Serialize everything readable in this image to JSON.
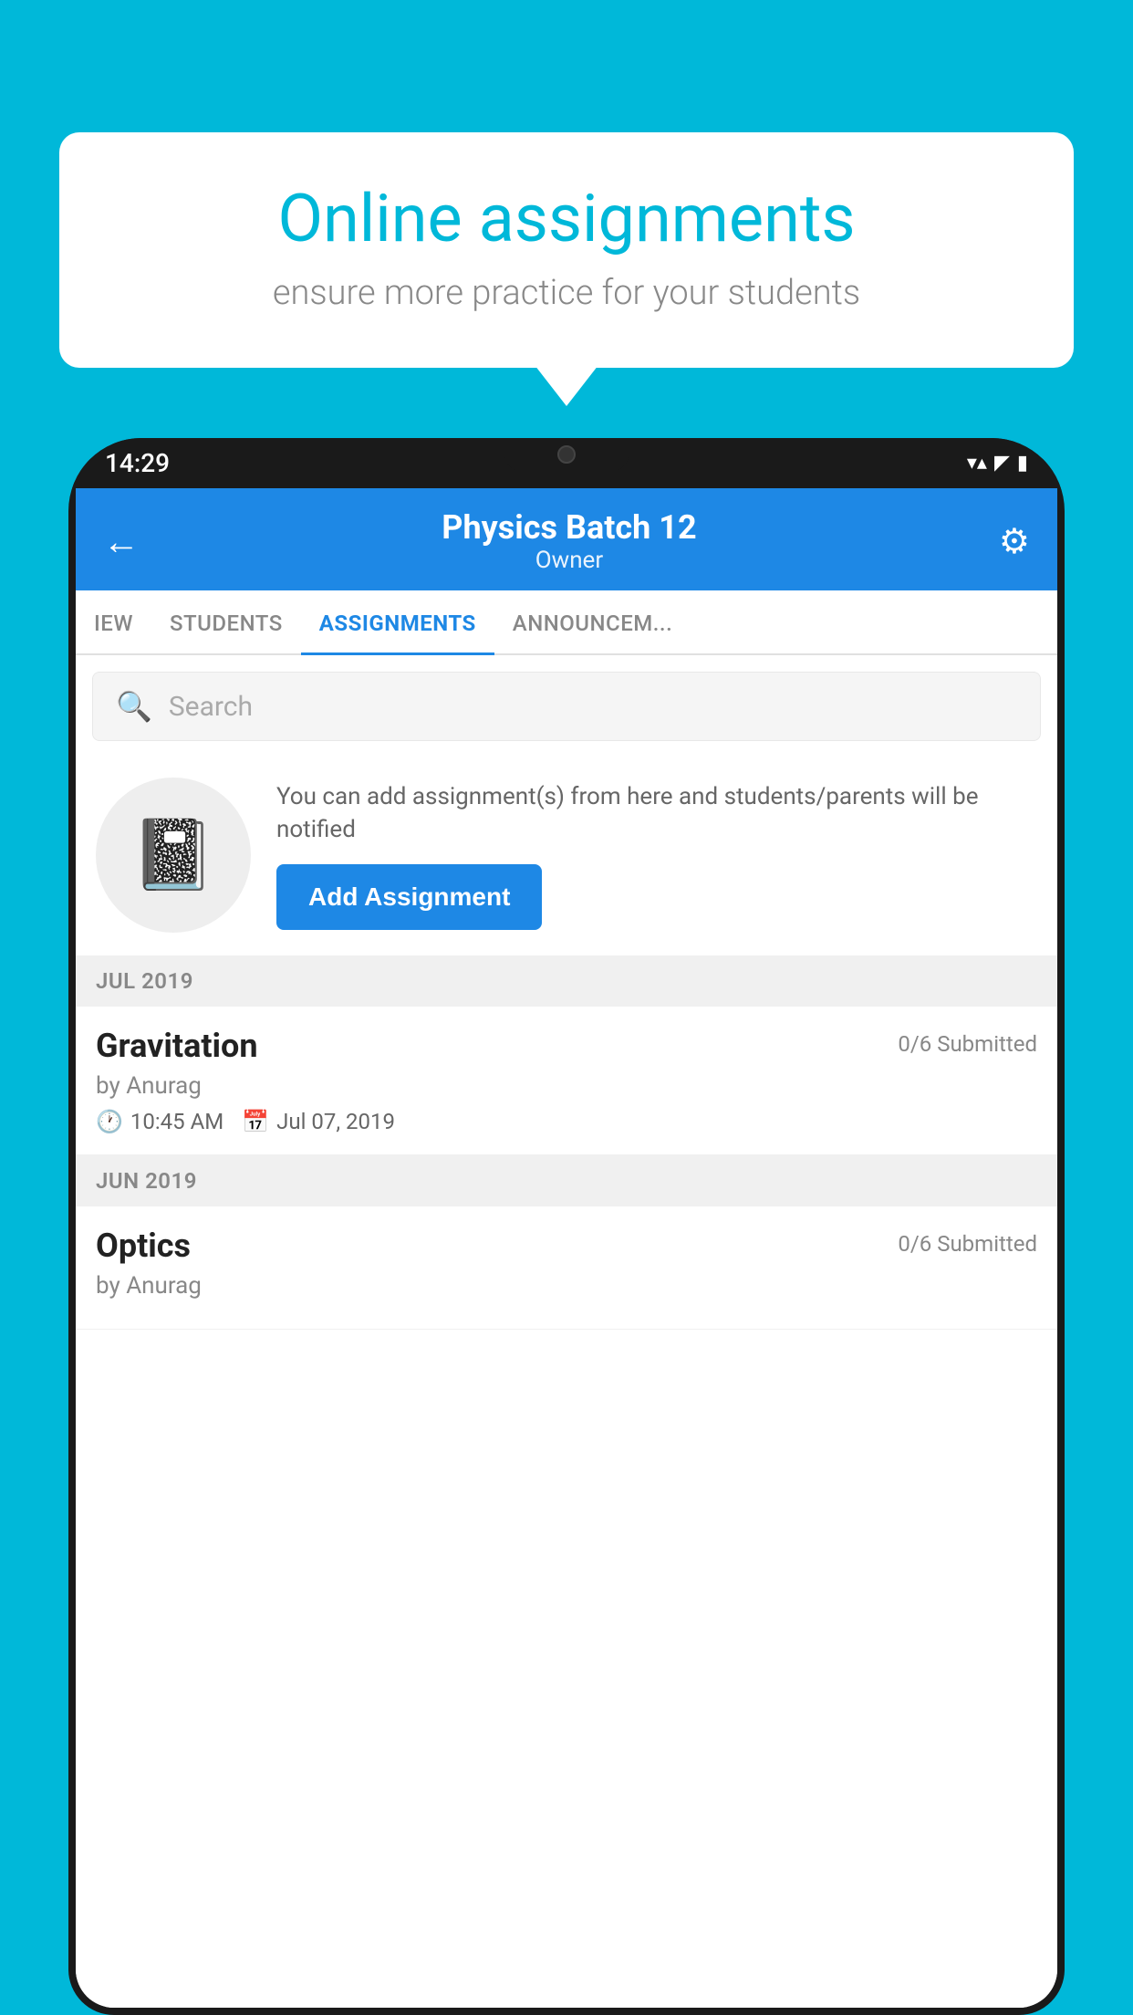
{
  "background": {
    "color": "#00B8D9"
  },
  "speech_bubble": {
    "title": "Online assignments",
    "subtitle": "ensure more practice for your students"
  },
  "phone": {
    "status_bar": {
      "time": "14:29",
      "wifi": "▼",
      "signal": "▲",
      "battery": "█"
    },
    "header": {
      "back_label": "←",
      "title": "Physics Batch 12",
      "subtitle": "Owner",
      "settings_label": "⚙"
    },
    "tabs": [
      {
        "label": "IEW",
        "active": false
      },
      {
        "label": "STUDENTS",
        "active": false
      },
      {
        "label": "ASSIGNMENTS",
        "active": true
      },
      {
        "label": "ANNOUNCEM...",
        "active": false
      }
    ],
    "search": {
      "placeholder": "Search"
    },
    "promo": {
      "description": "You can add assignment(s) from here and students/parents will be notified",
      "button_label": "Add Assignment"
    },
    "sections": [
      {
        "label": "JUL 2019",
        "assignments": [
          {
            "title": "Gravitation",
            "submitted": "0/6 Submitted",
            "by": "by Anurag",
            "time": "10:45 AM",
            "date": "Jul 07, 2019"
          }
        ]
      },
      {
        "label": "JUN 2019",
        "assignments": [
          {
            "title": "Optics",
            "submitted": "0/6 Submitted",
            "by": "by Anurag",
            "time": "",
            "date": ""
          }
        ]
      }
    ]
  }
}
